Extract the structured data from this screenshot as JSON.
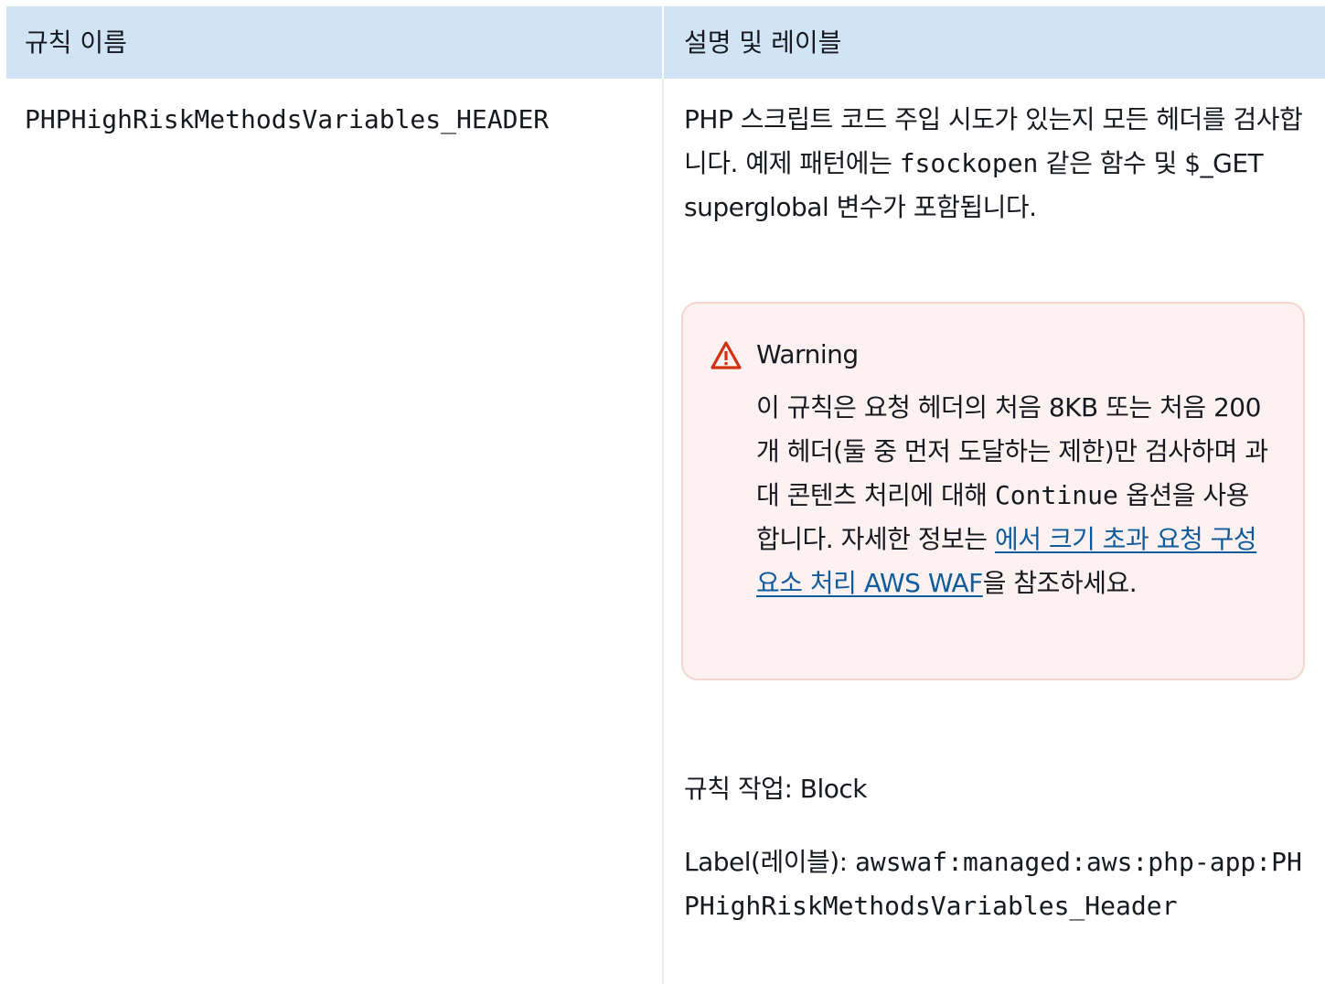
{
  "table": {
    "headers": {
      "rule_name": "규칙 이름",
      "description_and_label": "설명 및 레이블"
    },
    "rows": [
      {
        "rule_name": "PHPHighRiskMethodsVariables_HEADER",
        "description": {
          "text_before": "PHP 스크립트 코드 주입 시도가 있는지 모든 헤더를 검사합니다. 예제 패턴에는 ",
          "code_example": "fsockopen",
          "text_after": " 같은 함수 및 $_GET superglobal 변수가 포함됩니다."
        },
        "warning": {
          "icon": "warning-triangle-icon",
          "title": "Warning",
          "body_before": "이 규칙은 요청 헤더의 처음 8KB 또는 처음 200개 헤더(둘 중 먼저 도달하는 제한)만 검사하며 과대 콘텐츠 처리에 대해 ",
          "body_code": "Continue",
          "body_middle": " 옵션을 사용합니다. 자세한 정보는 ",
          "link_text": "에서 크기 초과 요청 구성 요소 처리 AWS WAF",
          "body_after": "을 참조하세요."
        },
        "rule_action": "규칙 작업: Block",
        "label_prefix": "Label(레이블): ",
        "label_value": "awswaf:managed:aws:php-app:PHPHighRiskMethodsVariables_Header"
      }
    ]
  },
  "colors": {
    "header_bg": "#d1e4f5",
    "warning_bg": "#fdf2f1",
    "warning_border": "#f5d5cf",
    "warning_icon": "#d13212",
    "link": "#0f5b9c",
    "text": "#16191f"
  }
}
